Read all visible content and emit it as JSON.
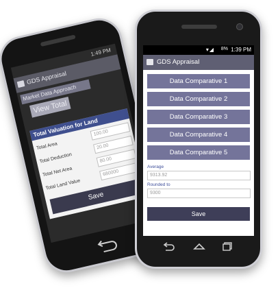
{
  "back_phone": {
    "status_text": "1:49 PM",
    "app_title": "GDS Appraisal",
    "tab_label": "Market Data Approach",
    "view_total_label": "View Total",
    "dialog": {
      "title": "Total Valuation for Land",
      "rows": [
        {
          "label": "Total Area",
          "value": "100.00"
        },
        {
          "label": "Total Deduction",
          "value": "20.00"
        },
        {
          "label": "Total Net Area",
          "value": "80.00"
        },
        {
          "label": "Total Land Value",
          "value": "680000"
        }
      ],
      "save_label": "Save"
    }
  },
  "front_phone": {
    "status": {
      "time": "1:39 PM",
      "battery": "8%"
    },
    "app_title": "GDS Appraisal",
    "comparatives": [
      "Data Comparative 1",
      "Data Comparative 2",
      "Data Comparative 3",
      "Data Comparative 4",
      "Data Comparative 5"
    ],
    "average_label": "Average",
    "average_value": "9313.92",
    "rounded_label": "Rounded to",
    "rounded_value": "9300",
    "save_label": "Save"
  },
  "icons": [
    "back-icon",
    "home-icon",
    "recents-icon",
    "wifi-icon",
    "signal-icon",
    "battery-icon",
    "app-logo-icon"
  ],
  "colors": {
    "accent": "#74749a",
    "appbar": "#5f5f73",
    "save": "#3e3e58",
    "dialog_title": "#3f4f8e"
  }
}
